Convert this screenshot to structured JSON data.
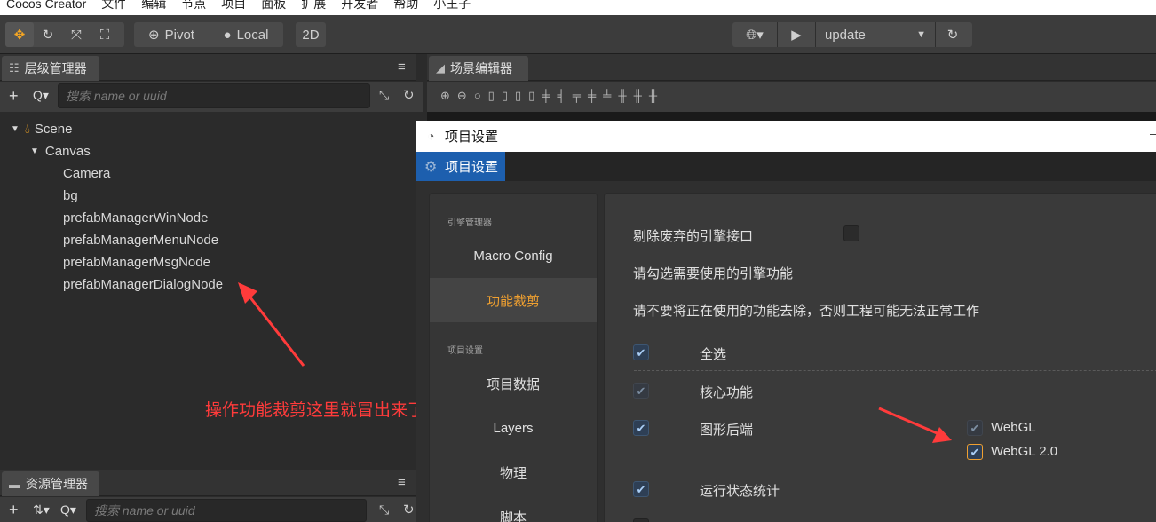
{
  "menubar": {
    "items": [
      "Cocos Creator",
      "文件",
      "编辑",
      "节点",
      "项目",
      "面板",
      "扩展",
      "开发者",
      "帮助",
      "小王子"
    ]
  },
  "toolbar": {
    "pivot_label": "Pivot",
    "local_label": "Local",
    "mode_2d": "2D",
    "platform_select": "update"
  },
  "hierarchy": {
    "tab_label": "层级管理器",
    "search_placeholder": "搜索 name or uuid",
    "nodes": [
      "Scene",
      "Canvas",
      "Camera",
      "bg",
      "prefabManagerWinNode",
      "prefabManagerMenuNode",
      "prefabManagerMsgNode",
      "prefabManagerDialogNode"
    ]
  },
  "annotation": {
    "text": "操作功能裁剪这里就冒出来了",
    "color": "#ff3b3b"
  },
  "scene_editor": {
    "tab_label": "场景编辑器"
  },
  "assets": {
    "tab_label": "资源管理器",
    "search_placeholder": "搜索 name or uuid"
  },
  "dialog": {
    "window_title": "项目设置",
    "tab_label": "项目设置",
    "nav": {
      "section_engine": "引擎管理器",
      "macro_config": "Macro Config",
      "feature_crop": "功能裁剪",
      "section_project": "项目设置",
      "project_data": "项目数据",
      "layers": "Layers",
      "physics": "物理",
      "script": "脚本"
    },
    "content": {
      "remove_deprecated": "剔除废弃的引擎接口",
      "choose_features": "请勾选需要使用的引擎功能",
      "warning": "请不要将正在使用的功能去除，否则工程可能无法正常工作",
      "select_all": "全选",
      "core": "核心功能",
      "graphics_backend": "图形后端",
      "webgl": "WebGL",
      "webgl2": "WebGL 2.0",
      "runtime_stats": "运行状态统计"
    }
  },
  "colors": {
    "accent_orange": "#f0a030",
    "dialog_tab_blue": "#1d5fae"
  }
}
